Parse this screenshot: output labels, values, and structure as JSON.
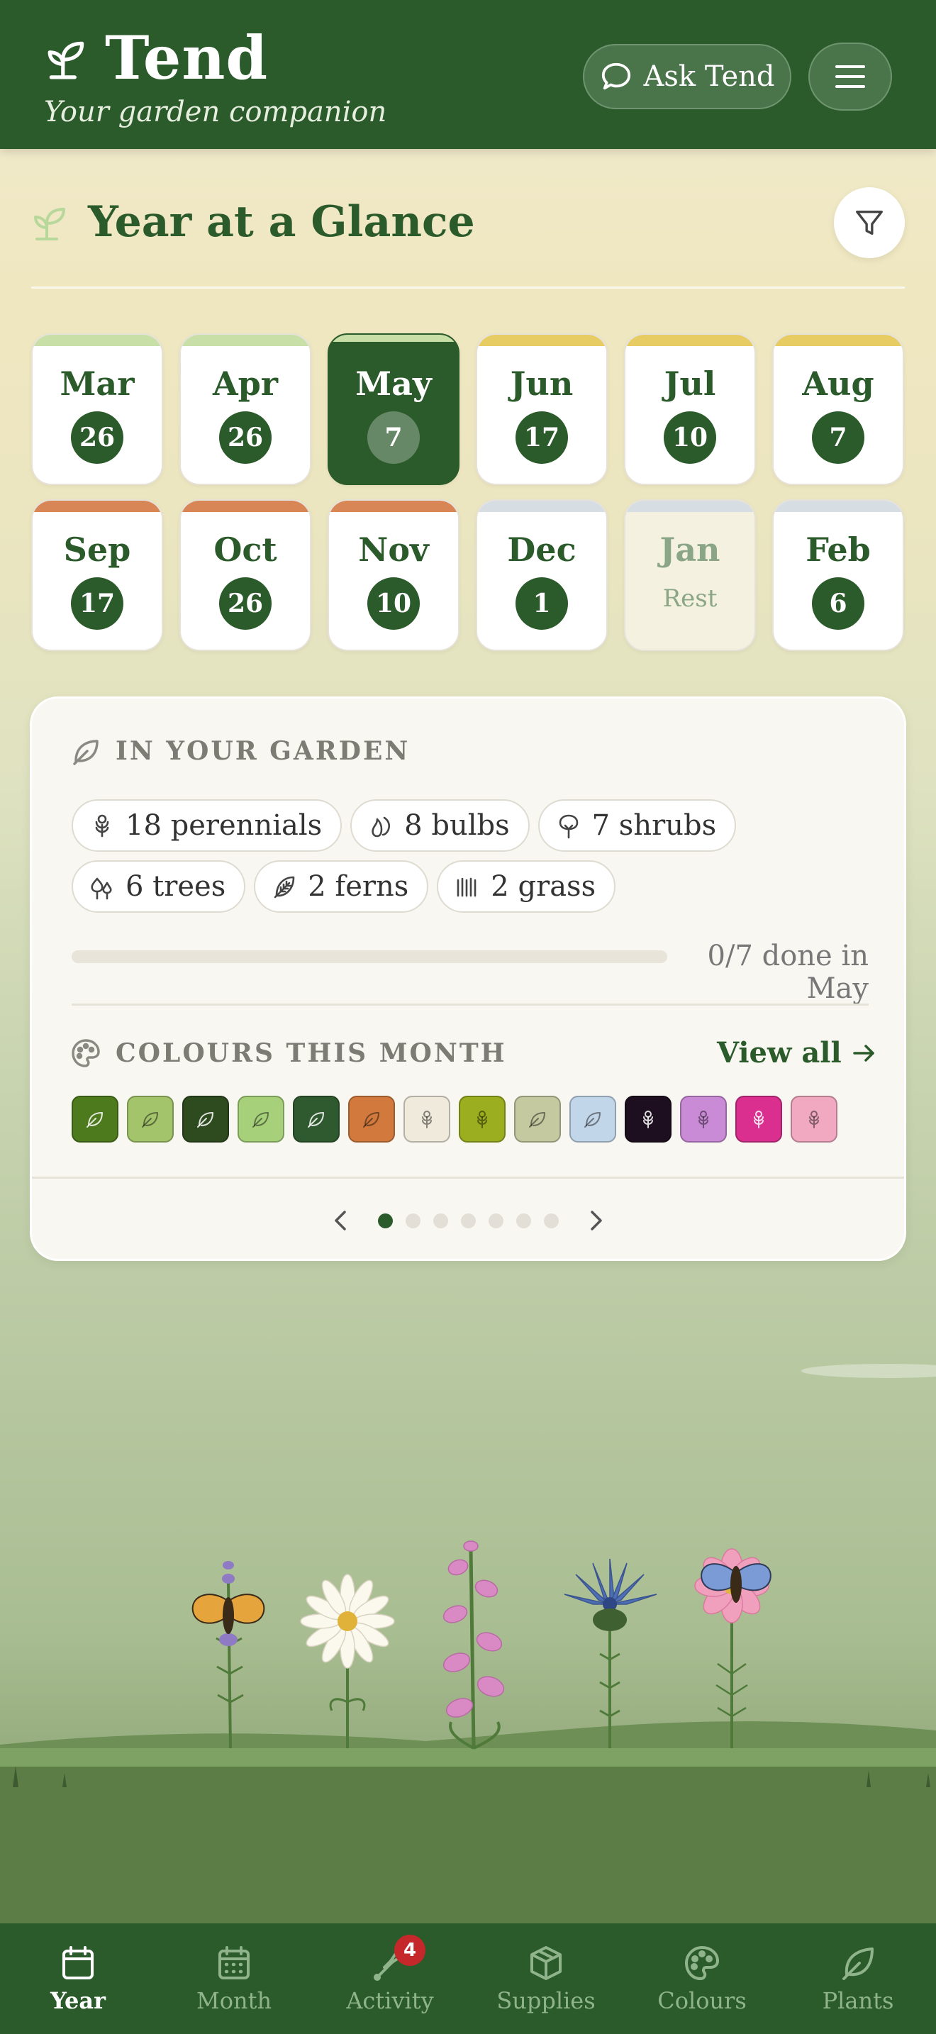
{
  "header": {
    "title": "Tend",
    "subtitle": "Your garden companion",
    "ask_label": "Ask Tend"
  },
  "glance": {
    "title": "Year at a Glance"
  },
  "months": [
    {
      "name": "Mar",
      "count": "26",
      "band": "#c9dfa8",
      "state": "normal"
    },
    {
      "name": "Apr",
      "count": "26",
      "band": "#c9dfa8",
      "state": "normal"
    },
    {
      "name": "May",
      "count": "7",
      "band": "#c9dfa8",
      "state": "active"
    },
    {
      "name": "Jun",
      "count": "17",
      "band": "#e6cc63",
      "state": "normal"
    },
    {
      "name": "Jul",
      "count": "10",
      "band": "#e6cc63",
      "state": "normal"
    },
    {
      "name": "Aug",
      "count": "7",
      "band": "#e6cc63",
      "state": "normal"
    },
    {
      "name": "Sep",
      "count": "17",
      "band": "#d98657",
      "state": "normal"
    },
    {
      "name": "Oct",
      "count": "26",
      "band": "#d98657",
      "state": "normal"
    },
    {
      "name": "Nov",
      "count": "10",
      "band": "#d98657",
      "state": "normal"
    },
    {
      "name": "Dec",
      "count": "1",
      "band": "#d6dde3",
      "state": "normal"
    },
    {
      "name": "Jan",
      "count": "Rest",
      "band": "#d6dde3",
      "state": "rest"
    },
    {
      "name": "Feb",
      "count": "6",
      "band": "#d6dde3",
      "state": "normal"
    }
  ],
  "garden": {
    "heading": "IN YOUR GARDEN",
    "chips": [
      {
        "label": "18 perennials",
        "icon": "perennial-icon"
      },
      {
        "label": "8 bulbs",
        "icon": "bulb-icon"
      },
      {
        "label": "7 shrubs",
        "icon": "shrub-icon"
      },
      {
        "label": "6 trees",
        "icon": "trees-icon"
      },
      {
        "label": "2 ferns",
        "icon": "fern-icon"
      },
      {
        "label": "2 grass",
        "icon": "grass-icon"
      }
    ],
    "progress_text": "0/7 done in May",
    "progress_fraction": 0,
    "colours_heading": "COLOURS THIS MONTH",
    "view_all": "View all",
    "swatches": [
      {
        "color": "#4e7a1e",
        "icon": "leaf"
      },
      {
        "color": "#a3c46a",
        "icon": "leaf"
      },
      {
        "color": "#2e4a1f",
        "icon": "leaf"
      },
      {
        "color": "#a6d17a",
        "icon": "leaf"
      },
      {
        "color": "#2f5a2f",
        "icon": "leaf"
      },
      {
        "color": "#d27a3e",
        "icon": "leaf"
      },
      {
        "color": "#efeadb",
        "icon": "flower"
      },
      {
        "color": "#9aae1f",
        "icon": "flower"
      },
      {
        "color": "#c5c9a0",
        "icon": "leaf"
      },
      {
        "color": "#c2d6ea",
        "icon": "leaf"
      },
      {
        "color": "#1d0f1f",
        "icon": "flower"
      },
      {
        "color": "#c98ad6",
        "icon": "flower"
      },
      {
        "color": "#da2f8f",
        "icon": "flower"
      },
      {
        "color": "#f0a9c0",
        "icon": "flower"
      }
    ],
    "pager_pages": 7,
    "pager_active": 0
  },
  "nav": [
    {
      "label": "Year",
      "icon": "calendar-icon",
      "active": true
    },
    {
      "label": "Month",
      "icon": "calendar-grid-icon",
      "active": false
    },
    {
      "label": "Activity",
      "icon": "trowel-icon",
      "active": false,
      "badge": "4"
    },
    {
      "label": "Supplies",
      "icon": "box-icon",
      "active": false
    },
    {
      "label": "Colours",
      "icon": "palette-icon",
      "active": false
    },
    {
      "label": "Plants",
      "icon": "leaf-icon",
      "active": false
    }
  ],
  "colors": {
    "brand": "#2b5a2b",
    "badge": "#c4282a"
  }
}
